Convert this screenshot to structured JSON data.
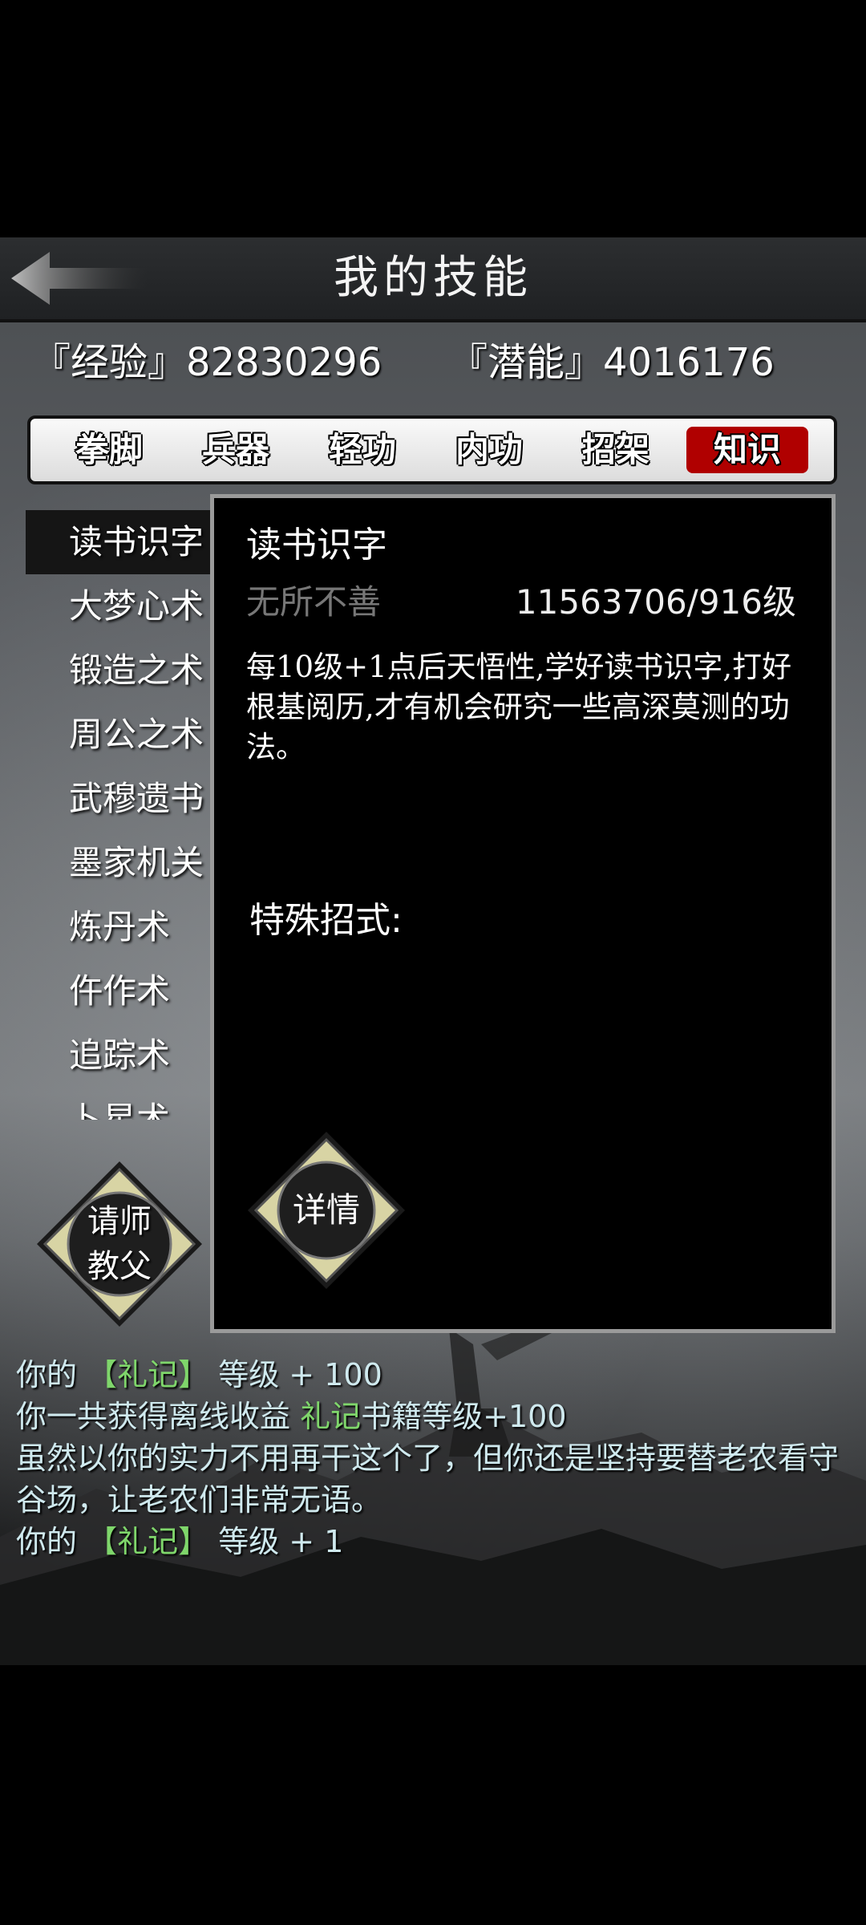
{
  "header": {
    "title": "我的技能"
  },
  "stats": {
    "experience": "『经验』82830296",
    "potential": "『潜能』4016176"
  },
  "tabs": [
    {
      "label": "拳脚"
    },
    {
      "label": "兵器"
    },
    {
      "label": "轻功"
    },
    {
      "label": "内功"
    },
    {
      "label": "招架"
    },
    {
      "label": "知识",
      "active": true
    }
  ],
  "skills": [
    {
      "label": "读书识字"
    },
    {
      "label": "大梦心术"
    },
    {
      "label": "锻造之术"
    },
    {
      "label": "周公之术"
    },
    {
      "label": "武穆遗书"
    },
    {
      "label": "墨家机关"
    },
    {
      "label": "炼丹术"
    },
    {
      "label": "仵作术"
    },
    {
      "label": "追踪术"
    },
    {
      "label": "卜星术"
    }
  ],
  "teacher_button": {
    "label": "请师\n教父"
  },
  "detail": {
    "name": "读书识字",
    "rank": "无所不善",
    "level": "11563706/916级",
    "description": "每10级+1点后天悟性,学好读书识字,打好根基阅历,才有机会研究一些高深莫测的功法。",
    "special_title": "特殊招式:",
    "detail_button": "详情"
  },
  "log": {
    "line1_prefix": "你的",
    "line1_item": "【礼记】",
    "line1_suffix": "等级 + 100",
    "line2_prefix": "你一共获得离线收益",
    "line2_item": "礼记",
    "line2_suffix": "书籍等级+100",
    "line3": "虽然以你的实力不用再干这个了，但你还是坚持要替老农看守谷场，让老农们非常无语。",
    "line4_prefix": "你的",
    "line4_item": "【礼记】",
    "line4_suffix": "等级 + 1"
  },
  "colors": {
    "active_tab": "#b00000",
    "log_highlight": "#7fd66b",
    "log_text": "#cfe9ee"
  }
}
